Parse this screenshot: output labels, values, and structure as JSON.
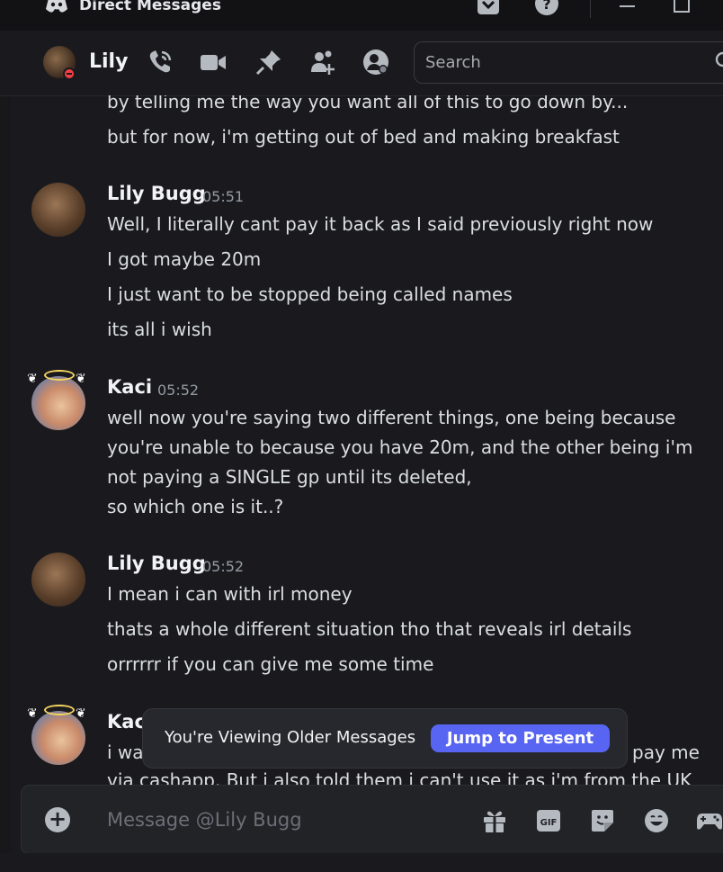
{
  "titlebar": {
    "title": "Direct Messages",
    "icons": [
      "discord-logo-icon",
      "inbox-icon",
      "help-icon",
      "minimize-icon",
      "maximize-icon"
    ]
  },
  "header": {
    "name": "Lily",
    "status": "do-not-disturb",
    "icons": [
      "voice-call-icon",
      "video-call-icon",
      "pinned-messages-icon",
      "add-friends-to-dm-icon",
      "user-profile-icon"
    ],
    "search_placeholder": "Search"
  },
  "messages": {
    "top_lines": [
      "by telling me the way you want all of this to go down by...",
      "but for now, i'm getting out of bed and making breakfast"
    ],
    "groups": [
      {
        "author": "Lily Bugg",
        "time": "05:51",
        "lines": [
          "Well, I literally cant pay it back as I said previously right now",
          "I got maybe 20m",
          "I just want to be stopped being called names",
          "its all i wish"
        ]
      },
      {
        "author": "Kaci",
        "time": "05:52",
        "lines": [
          "well now you're saying two different things, one being because",
          "you're unable to because you have 20m, and the other being i'm",
          "not paying a SINGLE gp until its deleted,",
          "so which one is it..?"
        ]
      },
      {
        "author": "Lily Bugg",
        "time": "05:52",
        "lines": [
          "I mean i can with irl money",
          "thats a whole different situation tho that reveals irl details",
          "orrrrrr if you can give me some time"
        ]
      },
      {
        "author": "Kac",
        "time": "",
        "lines": [
          "i wa",
          "pay me",
          "via cashapp. But i also told them i can't use it as i'm from the UK"
        ]
      }
    ]
  },
  "banner": {
    "text": "You're Viewing Older Messages",
    "button": "Jump to Present"
  },
  "composer": {
    "placeholder": "Message @Lily Bugg",
    "icons": [
      "attach-plus-icon",
      "gift-icon",
      "gif-icon",
      "sticker-icon",
      "emoji-icon",
      "activities-icon"
    ],
    "gif_label": "GIF"
  },
  "colors": {
    "accent": "#5865f2",
    "dnd": "#f23f43",
    "background": "#1a1a1e"
  }
}
